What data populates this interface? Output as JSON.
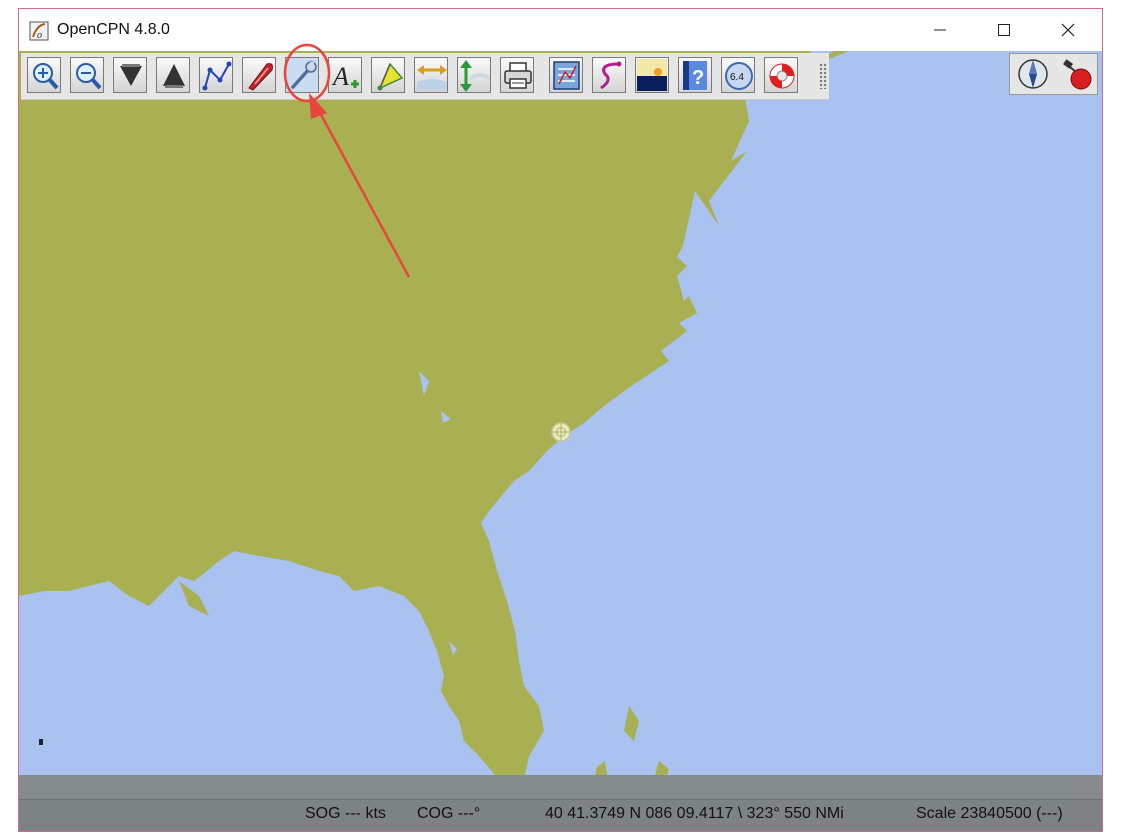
{
  "window": {
    "title": "OpenCPN 4.8.0"
  },
  "toolbar": {
    "tools": [
      "zoom-in-icon",
      "zoom-out-icon",
      "scale-down-icon",
      "scale-up-icon",
      "route-icon",
      "ship-icon",
      "options-wrench-icon",
      "text-icon",
      "tide-icon",
      "current-icon",
      "depth-icon",
      "print-icon",
      "route-manager-icon",
      "track-icon",
      "color-scheme-icon",
      "help-icon",
      "speed-icon",
      "mob-icon"
    ],
    "right_tools": [
      "compass-icon",
      "gps-status-icon"
    ],
    "speed_value": "6.4",
    "help_symbol": "?"
  },
  "status": {
    "sog": "SOG --- kts",
    "cog": "COG ---°",
    "position": "40 41.3749 N  086 09.4117 \\ 323°  550 NMi",
    "scale": "Scale 23840500 (---)"
  },
  "colors": {
    "water": "#aac2ef",
    "land": "#a8b052",
    "annotation": "#e8453c"
  }
}
